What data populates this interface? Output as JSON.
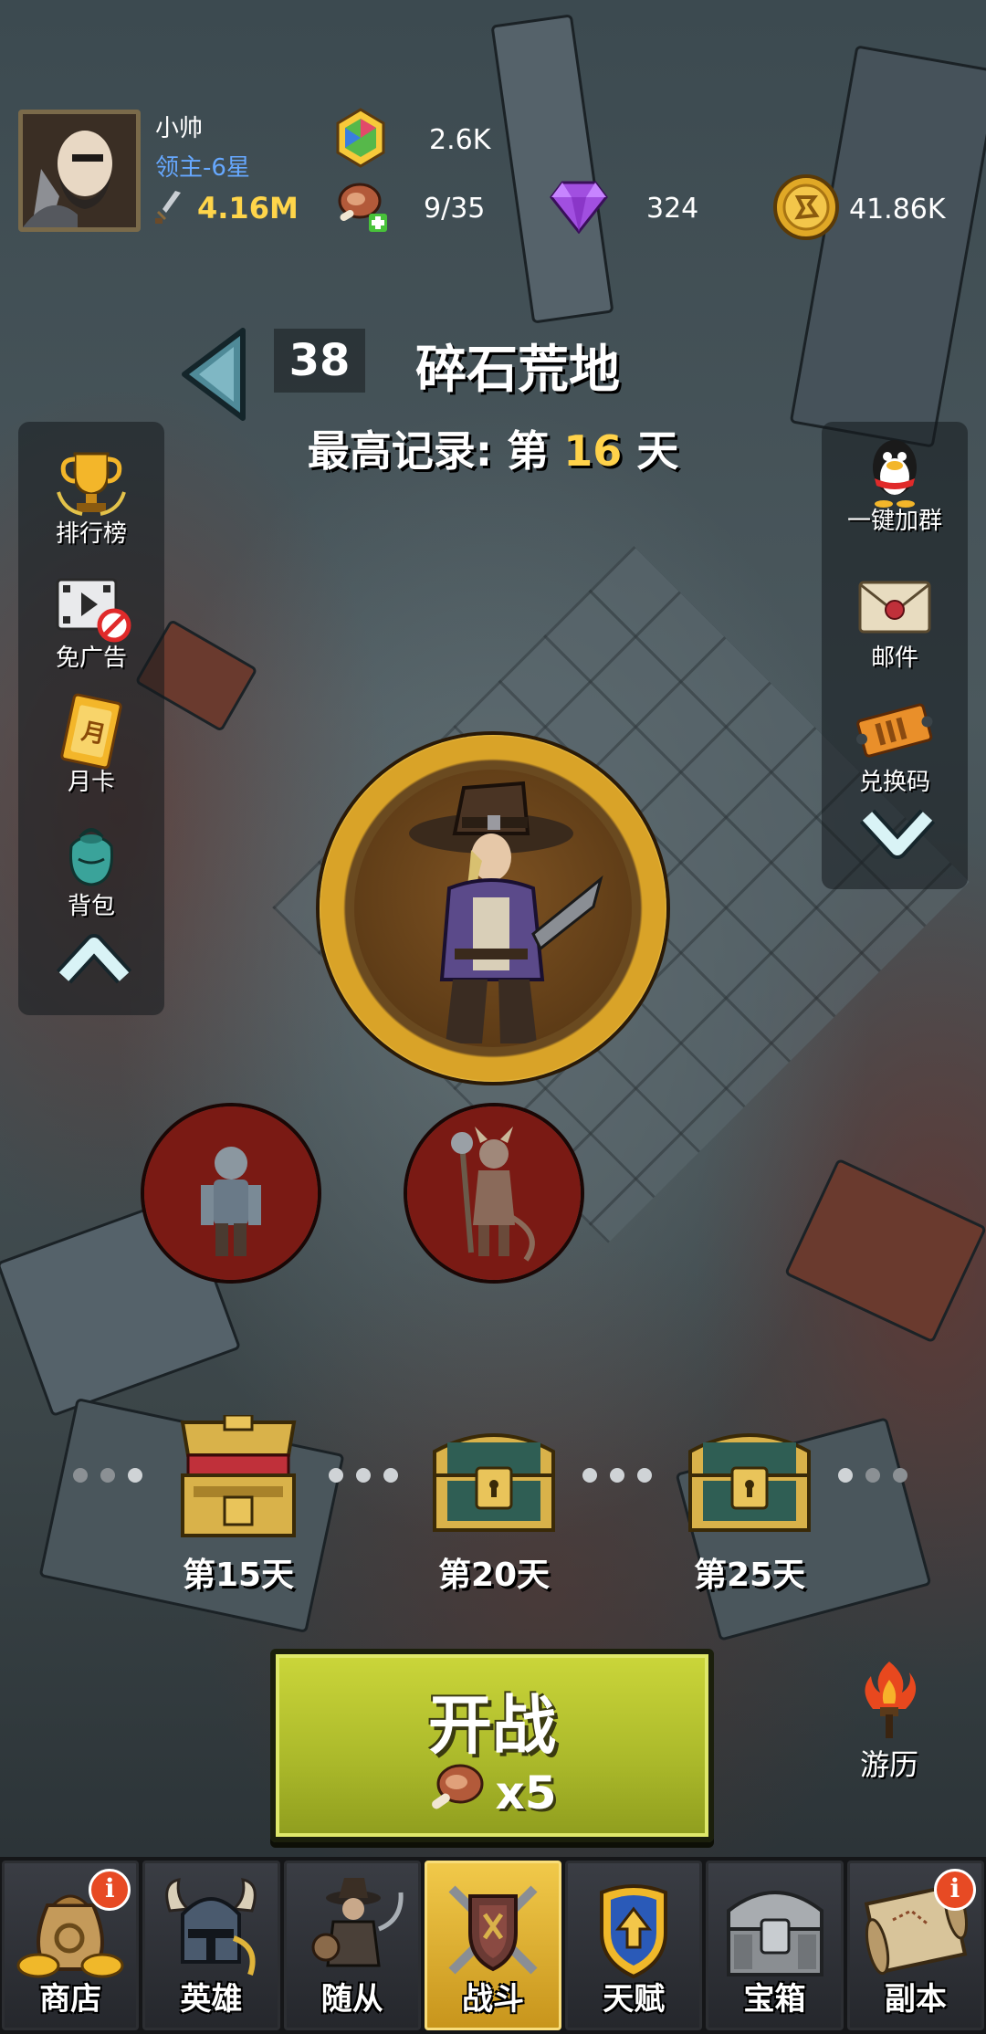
{
  "player": {
    "name": "小帅",
    "rank": "领主-6星",
    "power": "4.16M"
  },
  "resources": {
    "energy": "2.6K",
    "meat": "9/35",
    "gems": "324",
    "gold": "41.86K"
  },
  "stage": {
    "number": "38",
    "name": "碎石荒地",
    "record_prefix": "最高记录: 第",
    "record_day": "16",
    "record_suffix": "天"
  },
  "left_menu": [
    {
      "label": "排行榜",
      "icon": "trophy-icon"
    },
    {
      "label": "免广告",
      "icon": "no-ads-icon"
    },
    {
      "label": "月卡",
      "icon": "monthly-card-icon"
    },
    {
      "label": "背包",
      "icon": "backpack-icon"
    }
  ],
  "right_menu": [
    {
      "label": "一键加群",
      "icon": "qq-penguin-icon"
    },
    {
      "label": "邮件",
      "icon": "mail-icon"
    },
    {
      "label": "兑换码",
      "icon": "ticket-icon"
    }
  ],
  "milestones": [
    {
      "label": "第15天",
      "state": "opened"
    },
    {
      "label": "第20天",
      "state": "locked"
    },
    {
      "label": "第25天",
      "state": "locked"
    }
  ],
  "battle": {
    "label": "开战",
    "cost": "x5"
  },
  "side_action": {
    "label": "游历"
  },
  "nav": [
    {
      "label": "商店",
      "badge": "i",
      "active": false
    },
    {
      "label": "英雄",
      "badge": "",
      "active": false
    },
    {
      "label": "随从",
      "badge": "",
      "active": false
    },
    {
      "label": "战斗",
      "badge": "",
      "active": true
    },
    {
      "label": "天赋",
      "badge": "",
      "active": false
    },
    {
      "label": "宝箱",
      "badge": "",
      "active": false
    },
    {
      "label": "副本",
      "badge": "i",
      "active": false
    }
  ],
  "colors": {
    "gold_text": "#ffd54a",
    "rank_text": "#66a8ff",
    "battle_button": "#b6c22e",
    "active_tab": "#e4b43a"
  }
}
